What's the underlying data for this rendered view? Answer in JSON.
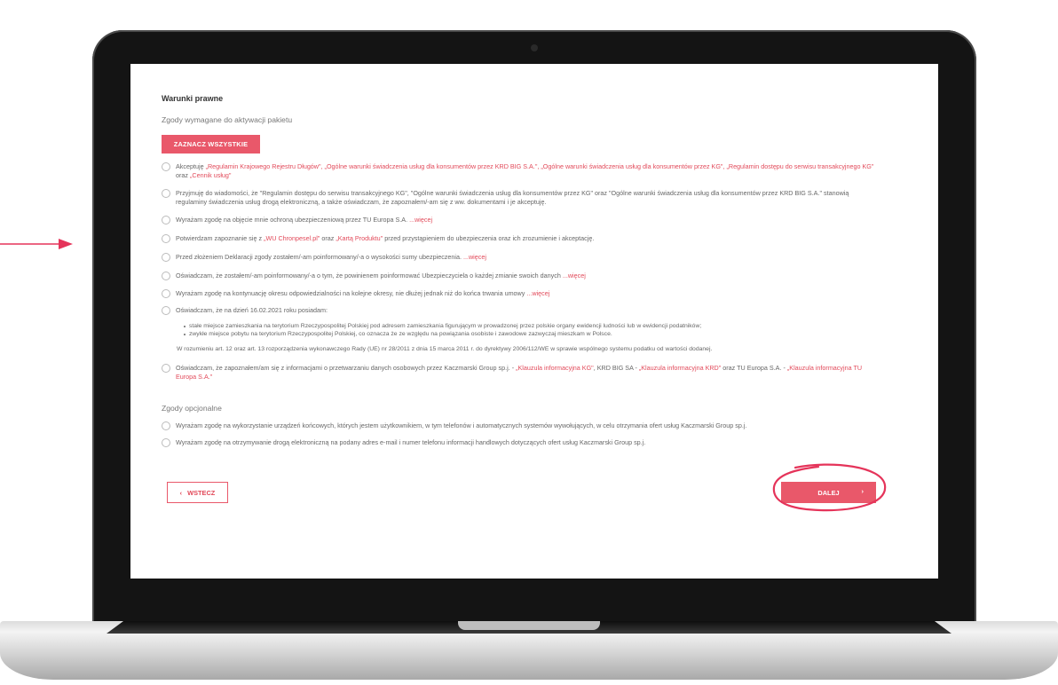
{
  "colors": {
    "accent": "#e9586a",
    "accent_text": "#e24a5a",
    "annotation": "#e5345a"
  },
  "icons": {
    "arrow": "arrow-right-icon",
    "back": "chevron-left-icon",
    "next": "chevron-right-icon",
    "radio": "radio-empty-icon"
  },
  "page": {
    "title": "Warunki prawne",
    "required_heading": "Zgody wymagane do aktywacji pakietu",
    "select_all_label": "ZAZNACZ WSZYSTKIE",
    "optional_heading": "Zgody opcjonalne",
    "back_label": "WSTECZ",
    "back_glyph": "‹",
    "next_label": "DALEJ",
    "next_glyph": "›"
  },
  "required": [
    {
      "pre": "Akceptuję ",
      "link1": "„Regulamin Krajowego Rejestru Długów\", „Ogólne warunki świadczenia usług dla konsumentów przez KRD BIG S.A.\", „Ogólne warunki świadczenia usług dla konsumentów przez KG\", „Regulamin dostępu do serwisu transakcyjnego KG\"",
      "mid": " oraz ",
      "link2": "„Cennik usług\""
    },
    {
      "text": "Przyjmuję do wiadomości, że \"Regulamin dostępu do serwisu transakcyjnego KG\", \"Ogólne warunki świadczenia usług dla konsumentów przez KG\" oraz \"Ogólne warunki świadczenia usług dla konsumentów przez KRD BIG S.A.\" stanowią regulaminy świadczenia usług drogą elektroniczną, a także oświadczam, że zapoznałem/-am się z ww. dokumentami i je akceptuję."
    },
    {
      "text": "Wyrażam zgodę na objęcie mnie ochroną ubezpieczeniową przez TU Europa S.A. ",
      "more": "...więcej"
    },
    {
      "pre": "Potwierdzam zapoznanie się z ",
      "link1": "„WU Chronpesel.pl\"",
      "mid": " oraz ",
      "link2": "„Kartą Produktu\"",
      "post": " przed przystąpieniem do ubezpieczenia oraz ich zrozumienie i akceptację."
    },
    {
      "text": "Przed złożeniem Deklaracji zgody zostałem/-am poinformowany/-a o wysokości sumy ubezpieczenia. ",
      "more": "...więcej"
    },
    {
      "text": "Oświadczam, że zostałem/-am poinformowany/-a o tym, że powinienem poinformować Ubezpieczyciela o każdej zmianie swoich danych ",
      "more": "...więcej"
    },
    {
      "text": "Wyrażam zgodę na kontynuację okresu odpowiedzialności na kolejne okresy, nie dłużej jednak niż do końca trwania umowy ",
      "more": "...więcej"
    },
    {
      "text": "Oświadczam, że na dzień 16.02.2021 roku posiadam:",
      "bullets": [
        "stałe miejsce zamieszkania na terytorium Rzeczypospolitej Polskiej pod adresem zamieszkania figurującym w prowadzonej przez polskie organy ewidencji ludności lub w ewidencji podatników;",
        "zwykłe miejsce pobytu na terytorium Rzeczypospolitej Polskiej, co oznacza że ze względu na powiązania osobiste i zawodowe zazwyczaj mieszkam w Polsce."
      ],
      "note": "W rozumieniu art. 12 oraz art. 13 rozporządzenia wykonawczego Rady (UE) nr 28/2011 z dnia 15 marca 2011 r. do dyrektywy 2006/112/WE w sprawie wspólnego systemu podatku od wartości dodanej."
    },
    {
      "pre": "Oświadczam, że zapoznałem/am się z informacjami o przetwarzaniu danych osobowych przez Kaczmarski Group sp.j. - ",
      "link1": "„Klauzula informacyjna KG\"",
      "mid": ", KRD BIG SA - ",
      "link2": "„Klauzula informacyjna KRD\"",
      "post": " oraz TU Europa S.A. - ",
      "link3": "„Klauzula informacyjna TU Europa S.A.\""
    }
  ],
  "optional": [
    {
      "text": "Wyrażam zgodę na wykorzystanie urządzeń końcowych, których jestem użytkownikiem, w tym telefonów i automatycznych systemów wywołujących, w celu otrzymania ofert usług Kaczmarski Group sp.j."
    },
    {
      "text": "Wyrażam zgodę na otrzymywanie drogą elektroniczną na podany adres e-mail i numer telefonu informacji handlowych dotyczących ofert usług Kaczmarski Group sp.j."
    }
  ]
}
